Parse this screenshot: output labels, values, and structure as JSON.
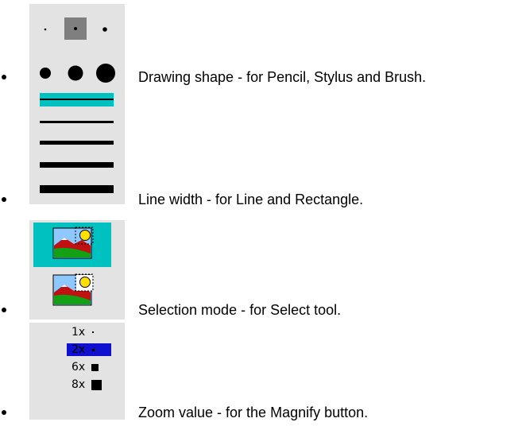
{
  "items": [
    {
      "label": "Drawing shape - for Pencil, Stylus and Brush.",
      "icon": "brush-shape-selector"
    },
    {
      "label": "Line width - for Line and Rectangle.",
      "icon": "line-width-selector"
    },
    {
      "label": "Selection mode - for Select tool.",
      "icon": "selection-mode-selector"
    },
    {
      "label": "Zoom value - for the Magnify button.",
      "icon": "zoom-selector",
      "options": [
        "1x",
        "2x",
        "6x",
        "8x"
      ],
      "selected": "2x"
    }
  ],
  "colors": {
    "panel": "#e3e3e3",
    "highlight_teal": "#00c0c0",
    "highlight_blue": "#1010d0",
    "sky_blue": "#8ec8ff",
    "land_red": "#c01010",
    "grass_green": "#14a014",
    "sun_yellow": "#ffe000"
  }
}
